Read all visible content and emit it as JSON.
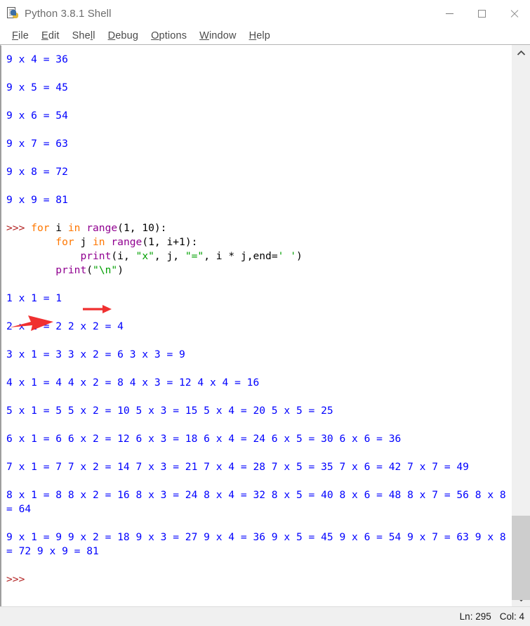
{
  "window": {
    "title": "Python 3.8.1 Shell",
    "icon": "python-idle-icon",
    "controls": {
      "minimize": "minimize-icon",
      "maximize": "maximize-icon",
      "close": "close-icon"
    }
  },
  "menu": {
    "items": [
      {
        "label": "File",
        "accel": "F",
        "rest": "ile"
      },
      {
        "label": "Edit",
        "accel": "E",
        "rest": "dit"
      },
      {
        "label": "Shell",
        "accel": "l",
        "pre": "She",
        "rest": "l"
      },
      {
        "label": "Debug",
        "accel": "D",
        "rest": "ebug"
      },
      {
        "label": "Options",
        "accel": "O",
        "rest": "ptions"
      },
      {
        "label": "Window",
        "accel": "W",
        "rest": "indow"
      },
      {
        "label": "Help",
        "accel": "H",
        "rest": "elp"
      }
    ]
  },
  "shell": {
    "prompt_symbol": ">>>",
    "top_output_lines": [
      "9 x 4 = 36",
      "9 x 5 = 45",
      "9 x 6 = 54",
      "9 x 7 = 63",
      "9 x 8 = 72",
      "9 x 9 = 81"
    ],
    "code_block": {
      "line1": {
        "prompt": ">>> ",
        "kw1": "for",
        "id1": " i ",
        "kw2": "in",
        "builtin": " range",
        "rest": "(1, 10):"
      },
      "line2": {
        "indent": "        ",
        "kw1": "for",
        "id1": " j ",
        "kw2": "in",
        "builtin": " range",
        "rest": "(1, i+1):"
      },
      "line3": {
        "indent": "            ",
        "builtin": "print",
        "p1": "(i, ",
        "s1": "\"x\"",
        "p2": ", j, ",
        "s2": "\"=\"",
        "p3": ", i * j,end=",
        "s3": "' '",
        "p4": ")"
      },
      "line4": {
        "indent": "        ",
        "builtin": "print",
        "p1": "(",
        "s1": "\"\\n\"",
        "p2": ")"
      }
    },
    "result_lines": [
      "1 x 1 = 1",
      "2 x 1 = 2 2 x 2 = 4",
      "3 x 1 = 3 3 x 2 = 6 3 x 3 = 9",
      "4 x 1 = 4 4 x 2 = 8 4 x 3 = 12 4 x 4 = 16",
      "5 x 1 = 5 5 x 2 = 10 5 x 3 = 15 5 x 4 = 20 5 x 5 = 25",
      "6 x 1 = 6 6 x 2 = 12 6 x 3 = 18 6 x 4 = 24 6 x 5 = 30 6 x 6 = 36",
      "7 x 1 = 7 7 x 2 = 14 7 x 3 = 21 7 x 4 = 28 7 x 5 = 35 7 x 6 = 42 7 x 7 = 49",
      "8 x 1 = 8 8 x 2 = 16 8 x 3 = 24 8 x 4 = 32 8 x 5 = 40 8 x 6 = 48 8 x 7 = 56 8 x 8 = 64",
      "9 x 1 = 9 9 x 2 = 18 9 x 3 = 27 9 x 4 = 36 9 x 5 = 45 9 x 6 = 54 9 x 7 = 63 9 x 8 = 72 9 x 9 = 81"
    ],
    "final_prompt": ">>>"
  },
  "annotations": {
    "arrow_small": "red-arrow-pointing-at-print-statement",
    "arrow_big": "red-arrow-pointing-at-print-newline",
    "color": "#f03030"
  },
  "scrollbar": {
    "up_arrow": "chevron-up-icon",
    "down_arrow": "chevron-down-icon"
  },
  "statusbar": {
    "line": "Ln: 295",
    "col": "Col: 4"
  },
  "colors": {
    "output_blue": "#0000ff",
    "prompt_red": "#b22222",
    "keyword_orange": "#ff7700",
    "builtin_purple": "#900090",
    "string_green": "#00a000",
    "annotation_red": "#f03030"
  }
}
